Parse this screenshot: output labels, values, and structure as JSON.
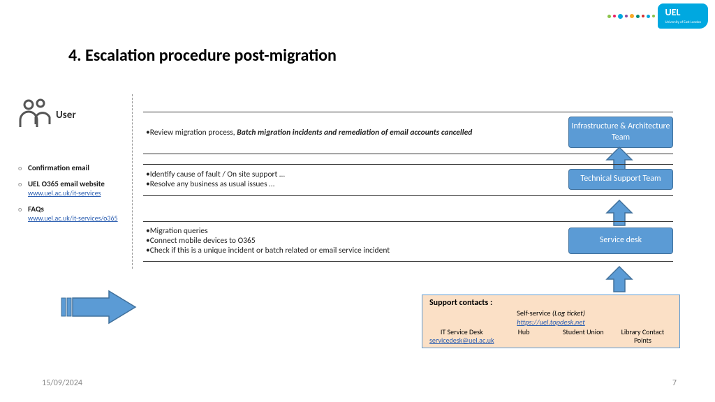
{
  "logo": {
    "name": "UEL",
    "subtitle": "University of East London"
  },
  "title": "4. Escalation procedure post-migration",
  "user_label": "User",
  "sidebar": {
    "items": [
      {
        "label": "Confirmation email",
        "link": ""
      },
      {
        "label": "UEL O365 email website",
        "link": "www.uel.ac.uk/it-services"
      },
      {
        "label": "FAQs",
        "link": "www.uel.ac.uk/it-services/o365"
      }
    ]
  },
  "tiers": [
    {
      "text_prefix": "•Review migration process, ",
      "text_bold": "Batch migration incidents and remediation of email accounts cancelled",
      "team": "Infrastructure & Architecture  Team"
    },
    {
      "lines": [
        "•Identify cause of fault / On site support …",
        "•Resolve any  business as usual issues …"
      ],
      "team": "Technical Support Team"
    },
    {
      "lines": [
        "•Migration queries",
        "•Connect mobile devices to O365",
        "•Check if this is a unique incident or batch related or email service incident"
      ],
      "team": "Service desk"
    }
  ],
  "support": {
    "title": "Support contacts :",
    "self_label": "Self-service ",
    "self_note": "(Log ticket)",
    "self_link": "https://uel.topdesk.net",
    "cols": [
      {
        "label": "IT Service Desk",
        "link": "servicedesk@uel.ac.uk"
      },
      {
        "label": "Hub"
      },
      {
        "label": "Student Union"
      },
      {
        "label": "Library Contact Points"
      }
    ]
  },
  "footer": {
    "date": "15/09/2024",
    "page": "7"
  }
}
